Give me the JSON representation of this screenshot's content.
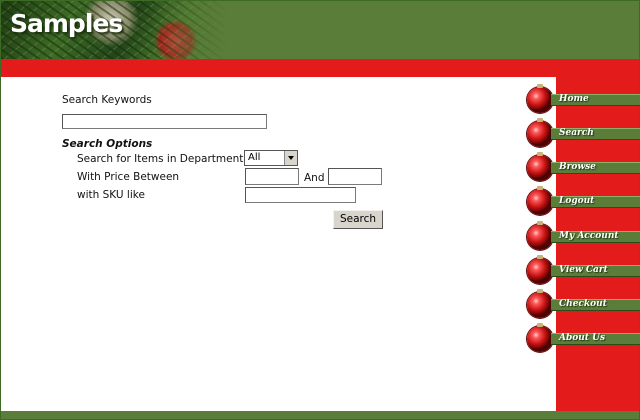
{
  "header": {
    "logo_text": "Samples"
  },
  "search": {
    "keywords_label": "Search Keywords",
    "keywords_value": "",
    "options_heading": "Search Options",
    "department_label": "Search for Items in Department",
    "department_selected": "All",
    "price_label": "With Price Between",
    "price_min_value": "",
    "price_and_label": "And",
    "price_max_value": "",
    "sku_label": "with SKU like",
    "sku_value": "",
    "submit_label": "Search"
  },
  "nav": {
    "items": [
      {
        "label": "Home",
        "icon": "ornament-icon"
      },
      {
        "label": "Search",
        "icon": "ornament-icon"
      },
      {
        "label": "Browse",
        "icon": "ornament-icon"
      },
      {
        "label": "Logout",
        "icon": "ornament-icon"
      },
      {
        "label": "My Account",
        "icon": "ornament-icon"
      },
      {
        "label": "View Cart",
        "icon": "ornament-icon"
      },
      {
        "label": "Checkout",
        "icon": "ornament-icon"
      },
      {
        "label": "About Us",
        "icon": "ornament-icon"
      }
    ]
  },
  "colors": {
    "header_green": "#5a7d3a",
    "accent_red": "#e31b1b"
  }
}
